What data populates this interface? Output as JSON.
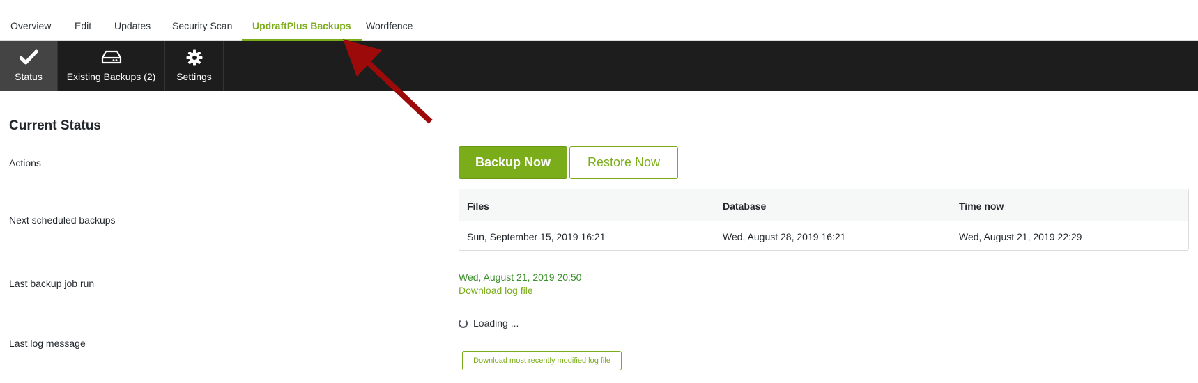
{
  "top_tabs": [
    {
      "label": "Overview"
    },
    {
      "label": "Edit"
    },
    {
      "label": "Updates"
    },
    {
      "label": "Security Scan"
    },
    {
      "label": "UpdraftPlus Backups"
    },
    {
      "label": "Wordfence"
    }
  ],
  "subnav": {
    "status": "Status",
    "existing": "Existing Backups (2)",
    "settings": "Settings"
  },
  "section": {
    "title": "Current Status"
  },
  "labels": {
    "actions": "Actions",
    "next_scheduled": "Next scheduled backups",
    "last_job": "Last backup job run",
    "last_log": "Last log message"
  },
  "actions": {
    "backup_now": "Backup Now",
    "restore_now": "Restore Now"
  },
  "schedule": {
    "headers": [
      "Files",
      "Database",
      "Time now"
    ],
    "values": [
      "Sun, September 15, 2019 16:21",
      "Wed, August 28, 2019 16:21",
      "Wed, August 21, 2019 22:29"
    ]
  },
  "last_job": {
    "time": "Wed, August 21, 2019 20:50",
    "download_link": "Download log file"
  },
  "last_log": {
    "loading": "Loading ...",
    "download_button": "Download most recently modified log file"
  },
  "colors": {
    "accent": "#7bad1a",
    "nav_bg": "#1d1d1d",
    "arrow": "#9c0a0a"
  }
}
